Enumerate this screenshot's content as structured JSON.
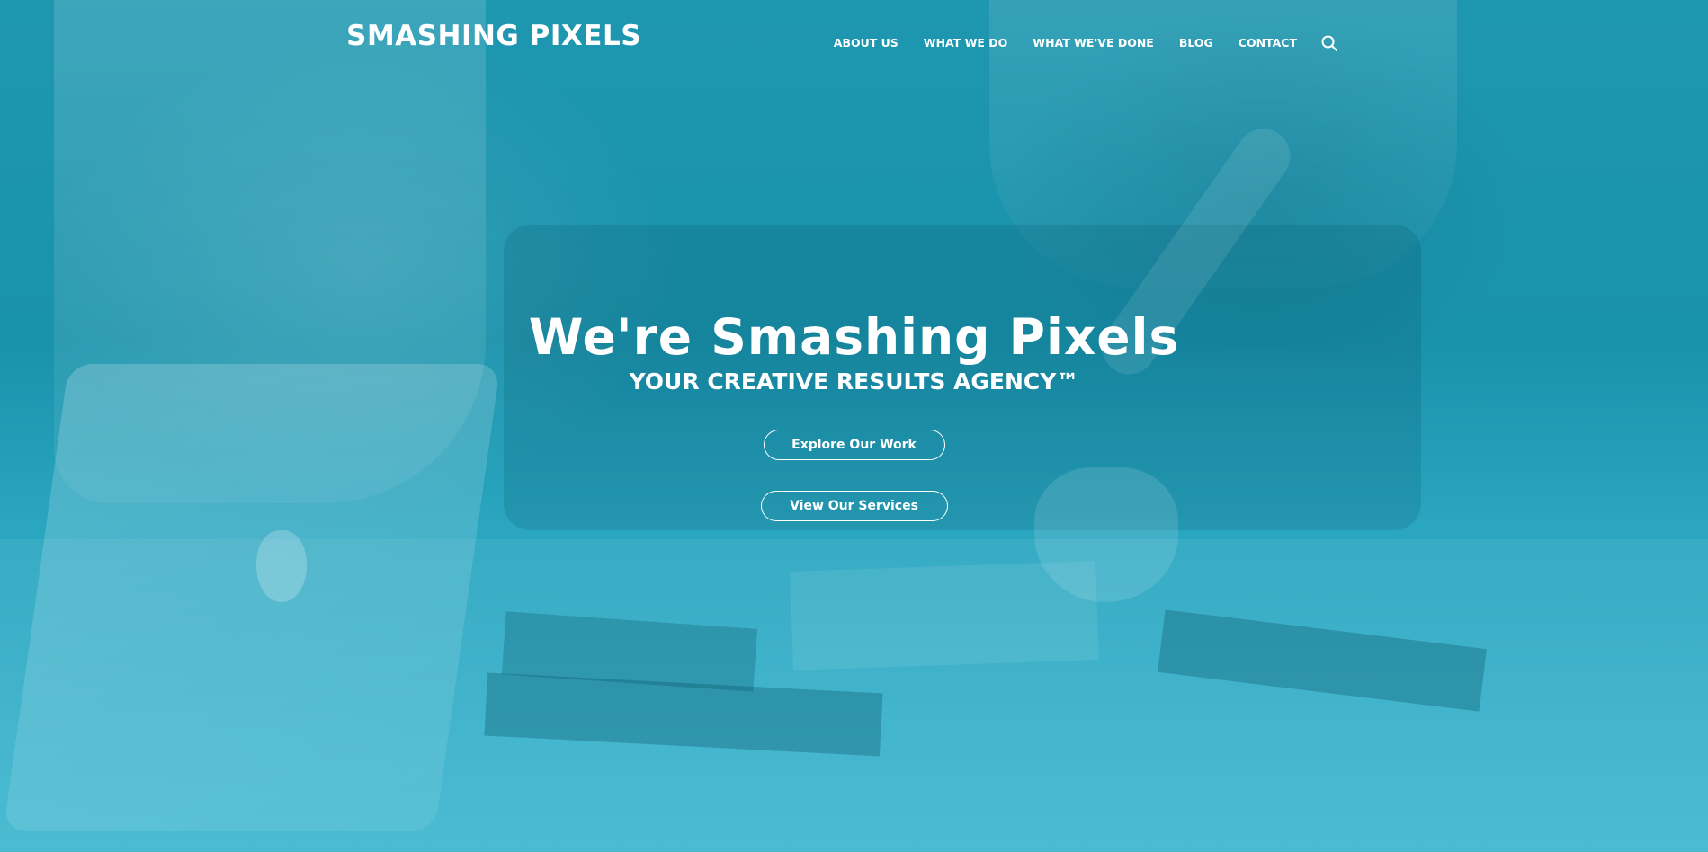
{
  "header": {
    "logo_text": "SMASHING PIXELS",
    "nav": [
      {
        "label": "ABOUT US"
      },
      {
        "label": "WHAT WE DO"
      },
      {
        "label": "WHAT WE'VE DONE"
      },
      {
        "label": "BLOG"
      },
      {
        "label": "CONTACT"
      }
    ],
    "search_icon": "search-icon"
  },
  "hero": {
    "title": "We're Smashing Pixels",
    "subtitle": "YOUR CREATIVE RESULTS AGENCY™",
    "buttons": [
      {
        "label": "Explore Our Work"
      },
      {
        "label": "View Our Services"
      }
    ]
  },
  "colors": {
    "overlay": "#2ea9c3",
    "text": "#ffffff"
  }
}
